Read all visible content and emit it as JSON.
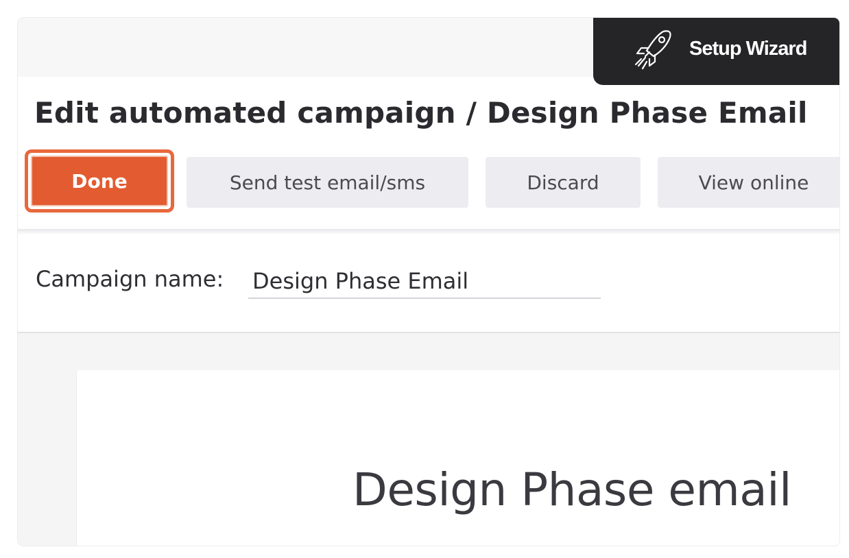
{
  "header": {
    "setup_wizard_label": "Setup Wizard",
    "wizard_icon": "rocket-icon",
    "page_title": "Edit automated campaign / Design Phase Email"
  },
  "toolbar": {
    "done_label": "Done",
    "send_test_label": "Send test email/sms",
    "discard_label": "Discard",
    "view_online_label": "View online"
  },
  "campaign": {
    "name_label": "Campaign name:",
    "name_value": "Design Phase Email"
  },
  "email_preview": {
    "heading": "Design Phase email"
  },
  "colors": {
    "accent": "#e35b30",
    "wizard_bg": "#252527",
    "button_bg": "#ececf1"
  }
}
